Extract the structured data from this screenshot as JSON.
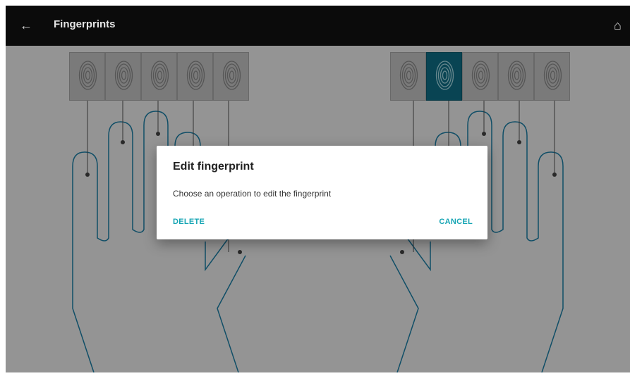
{
  "app_bar": {
    "title": "Fingerprints",
    "back_icon": "arrow-left-icon",
    "home_icon": "home-icon",
    "background": "#0b0b0b"
  },
  "fingers": {
    "left_hand_count": 5,
    "right_hand_count": 5,
    "selected": "right-hand-finger-2",
    "selected_color": "#0f6f86",
    "hand_outline_color": "#1b7fa6"
  },
  "dialog": {
    "title": "Edit fingerprint",
    "message": "Choose an operation to edit the fingerprint",
    "delete_label": "DELETE",
    "cancel_label": "CANCEL",
    "accent": "#16a5b4"
  }
}
